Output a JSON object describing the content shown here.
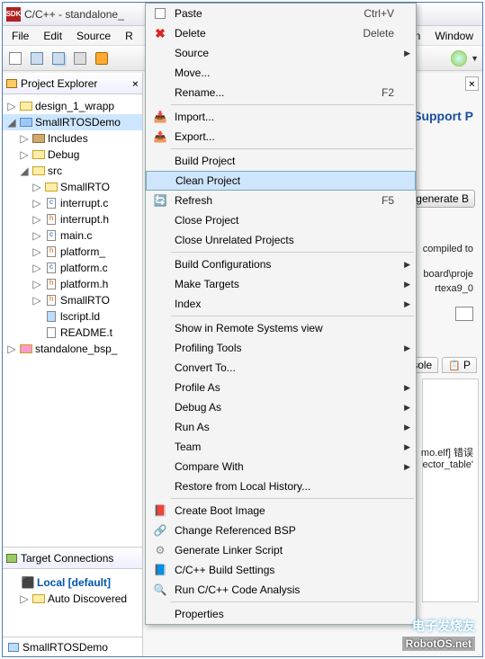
{
  "title": "C/C++ - standalone_",
  "menubar": [
    "File",
    "Edit",
    "Source",
    "R",
    "un",
    "Window"
  ],
  "views": {
    "project_explorer": "Project Explorer",
    "target_connections": "Target Connections",
    "status": "SmallRTOSDemo"
  },
  "tree": {
    "n1": "design_1_wrapp",
    "n2": "SmallRTOSDemo",
    "n3": "Includes",
    "n4": "Debug",
    "n5": "src",
    "n6": "SmallRTO",
    "n7": "interrupt.c",
    "n8": "interrupt.h",
    "n9": "main.c",
    "n10": "platform_",
    "n11": "platform.c",
    "n12": "platform.h",
    "n13": "SmallRTO",
    "n14": "lscript.ld",
    "n15": "README.t",
    "n16": "standalone_bsp_"
  },
  "target": {
    "local": "Local [default]",
    "auto": "Auto Discovered"
  },
  "ctx": {
    "paste": "Paste",
    "paste_sc": "Ctrl+V",
    "delete": "Delete",
    "delete_sc": "Delete",
    "source": "Source",
    "move": "Move...",
    "rename": "Rename...",
    "rename_sc": "F2",
    "import": "Import...",
    "export": "Export...",
    "build": "Build Project",
    "clean": "Clean Project",
    "refresh": "Refresh",
    "refresh_sc": "F5",
    "close": "Close Project",
    "close_unrel": "Close Unrelated Projects",
    "build_cfg": "Build Configurations",
    "make_targets": "Make Targets",
    "index": "Index",
    "remote": "Show in Remote Systems view",
    "profiling": "Profiling Tools",
    "convert": "Convert To...",
    "profile_as": "Profile As",
    "debug_as": "Debug As",
    "run_as": "Run As",
    "team": "Team",
    "compare": "Compare With",
    "restore": "Restore from Local History...",
    "boot": "Create Boot Image",
    "change_bsp": "Change Referenced BSP",
    "linker": "Generate Linker Script",
    "build_settings": "C/C++ Build Settings",
    "code_analysis": "Run C/C++ Code Analysis",
    "properties": "Properties"
  },
  "right": {
    "support": "Support P",
    "regen": "e-generate B",
    "compiled": "compiled to",
    "board": "board\\proje",
    "rtex": "rtexa9_0",
    "console": "nsole",
    "p": "P",
    "elf": "mo.elf] 错误",
    "vec": "ector_table'"
  },
  "watermark1": "电子发烧友",
  "watermark2": "RobotOS.net"
}
